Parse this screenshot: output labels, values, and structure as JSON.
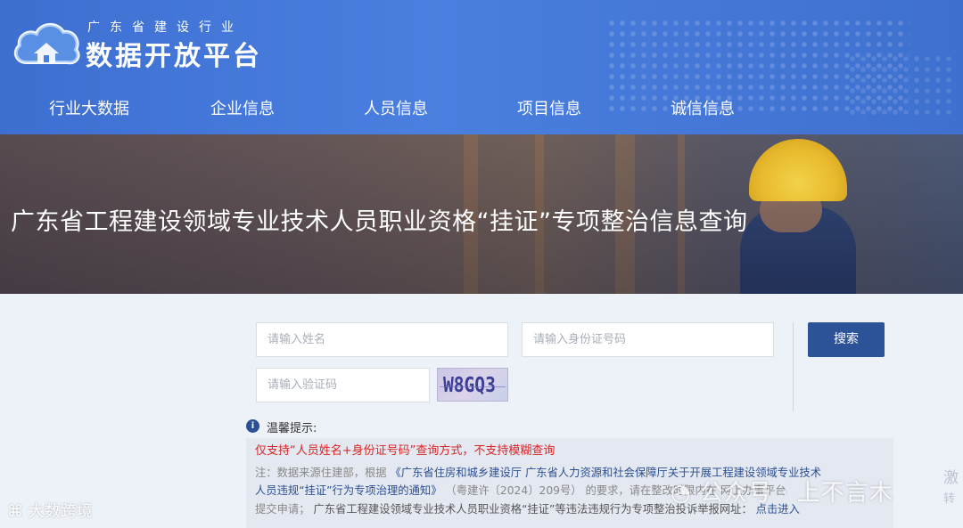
{
  "header": {
    "subtitle": "广东省建设行业",
    "title": "数据开放平台",
    "logo_icon": "cloud-house-icon"
  },
  "nav": {
    "items": [
      {
        "label": "行业大数据"
      },
      {
        "label": "企业信息"
      },
      {
        "label": "人员信息"
      },
      {
        "label": "项目信息"
      },
      {
        "label": "诚信信息"
      }
    ]
  },
  "banner": {
    "title": "广东省工程建设领域专业技术人员职业资格“挂证”专项整治信息查询"
  },
  "search": {
    "name_placeholder": "请输入姓名",
    "id_placeholder": "请输入身份证号码",
    "captcha_placeholder": "请输入验证码",
    "captcha_text": "W8GQ3",
    "button_label": "搜索"
  },
  "tips": {
    "title": "温馨提示:",
    "warning": "仅支持“人员姓名+身份证号码”查询方式，不支持模糊查询",
    "note_line1_prefix": "注：数据来源住建部，根据",
    "note_line1_link": "《广东省住房和城乡建设厅 广东省人力资源和社会保障厅关于开展工程建设领域专业技术",
    "note_line2_link": "人员违规“挂证”行为专项治理的通知》",
    "note_line2_suffix": "（粤建许〔2024〕209号） 的要求，请在整改时限内在  网上办事平台",
    "note_line3_prefix": "提交申请；",
    "note_line3_text": "广东省工程建设领域专业技术人员职业资格“挂证”等违法违规行为专项整治投诉举报网址：",
    "note_line3_action": "点击进入"
  },
  "watermarks": {
    "left": "大数跨境",
    "right": "公众号 · 上不言木",
    "far_right_1": "激",
    "far_right_2": "转"
  },
  "colors": {
    "header_blue": "#4a7fe0",
    "button_blue": "#2c5298",
    "warning_red": "#d92525"
  }
}
